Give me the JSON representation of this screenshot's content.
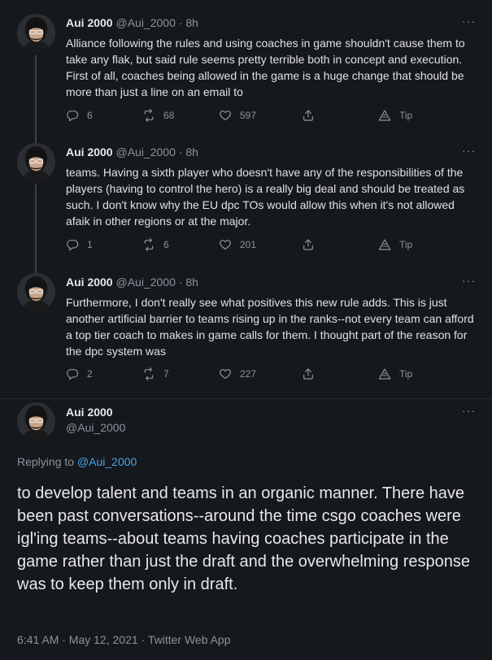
{
  "tweets": [
    {
      "name": "Aui 2000",
      "handle": "@Aui_2000",
      "dot": "·",
      "time": "8h",
      "more": "···",
      "text": "Alliance following the rules and using coaches in game shouldn't cause them to take any flak, but said rule seems pretty terrible both in concept and execution. First of all, coaches being allowed in the game is a huge change that should be more than just a line on an email to",
      "replies": "6",
      "retweets": "68",
      "likes": "597",
      "tip": "Tip"
    },
    {
      "name": "Aui 2000",
      "handle": "@Aui_2000",
      "dot": "·",
      "time": "8h",
      "more": "···",
      "text": "teams. Having a sixth player who doesn't have any of the responsibilities of the players (having to control the hero) is a really big deal and should be treated as such. I don't know why the EU dpc TOs would allow this when it's not allowed afaik in other regions or at the major.",
      "replies": "1",
      "retweets": "6",
      "likes": "201",
      "tip": "Tip"
    },
    {
      "name": "Aui 2000",
      "handle": "@Aui_2000",
      "dot": "·",
      "time": "8h",
      "more": "···",
      "text": "Furthermore, I don't really see what positives this new rule adds. This is just another artificial barrier to teams rising up in the ranks--not every team can afford a top tier coach to makes in game calls for them. I thought part of the reason for the dpc system was",
      "replies": "2",
      "retweets": "7",
      "likes": "227",
      "tip": "Tip"
    }
  ],
  "main": {
    "name": "Aui 2000",
    "handle": "@Aui_2000",
    "more": "···",
    "replying_label": "Replying to",
    "replying_handle": "@Aui_2000",
    "text": "to develop talent and teams in an organic manner. There have been past conversations--around the time csgo coaches were igl'ing teams--about teams having coaches participate in the game rather than just the draft and the overwhelming response was to keep them only in draft.",
    "meta": "6:41 AM · May 12, 2021 · Twitter Web App"
  },
  "colors": {
    "background": "#15181c",
    "link": "#4aa3e8",
    "muted": "#8b949e"
  },
  "icons": [
    "avatar",
    "reply-icon",
    "retweet-icon",
    "like-icon",
    "share-icon",
    "tip-icon",
    "more-icon"
  ]
}
